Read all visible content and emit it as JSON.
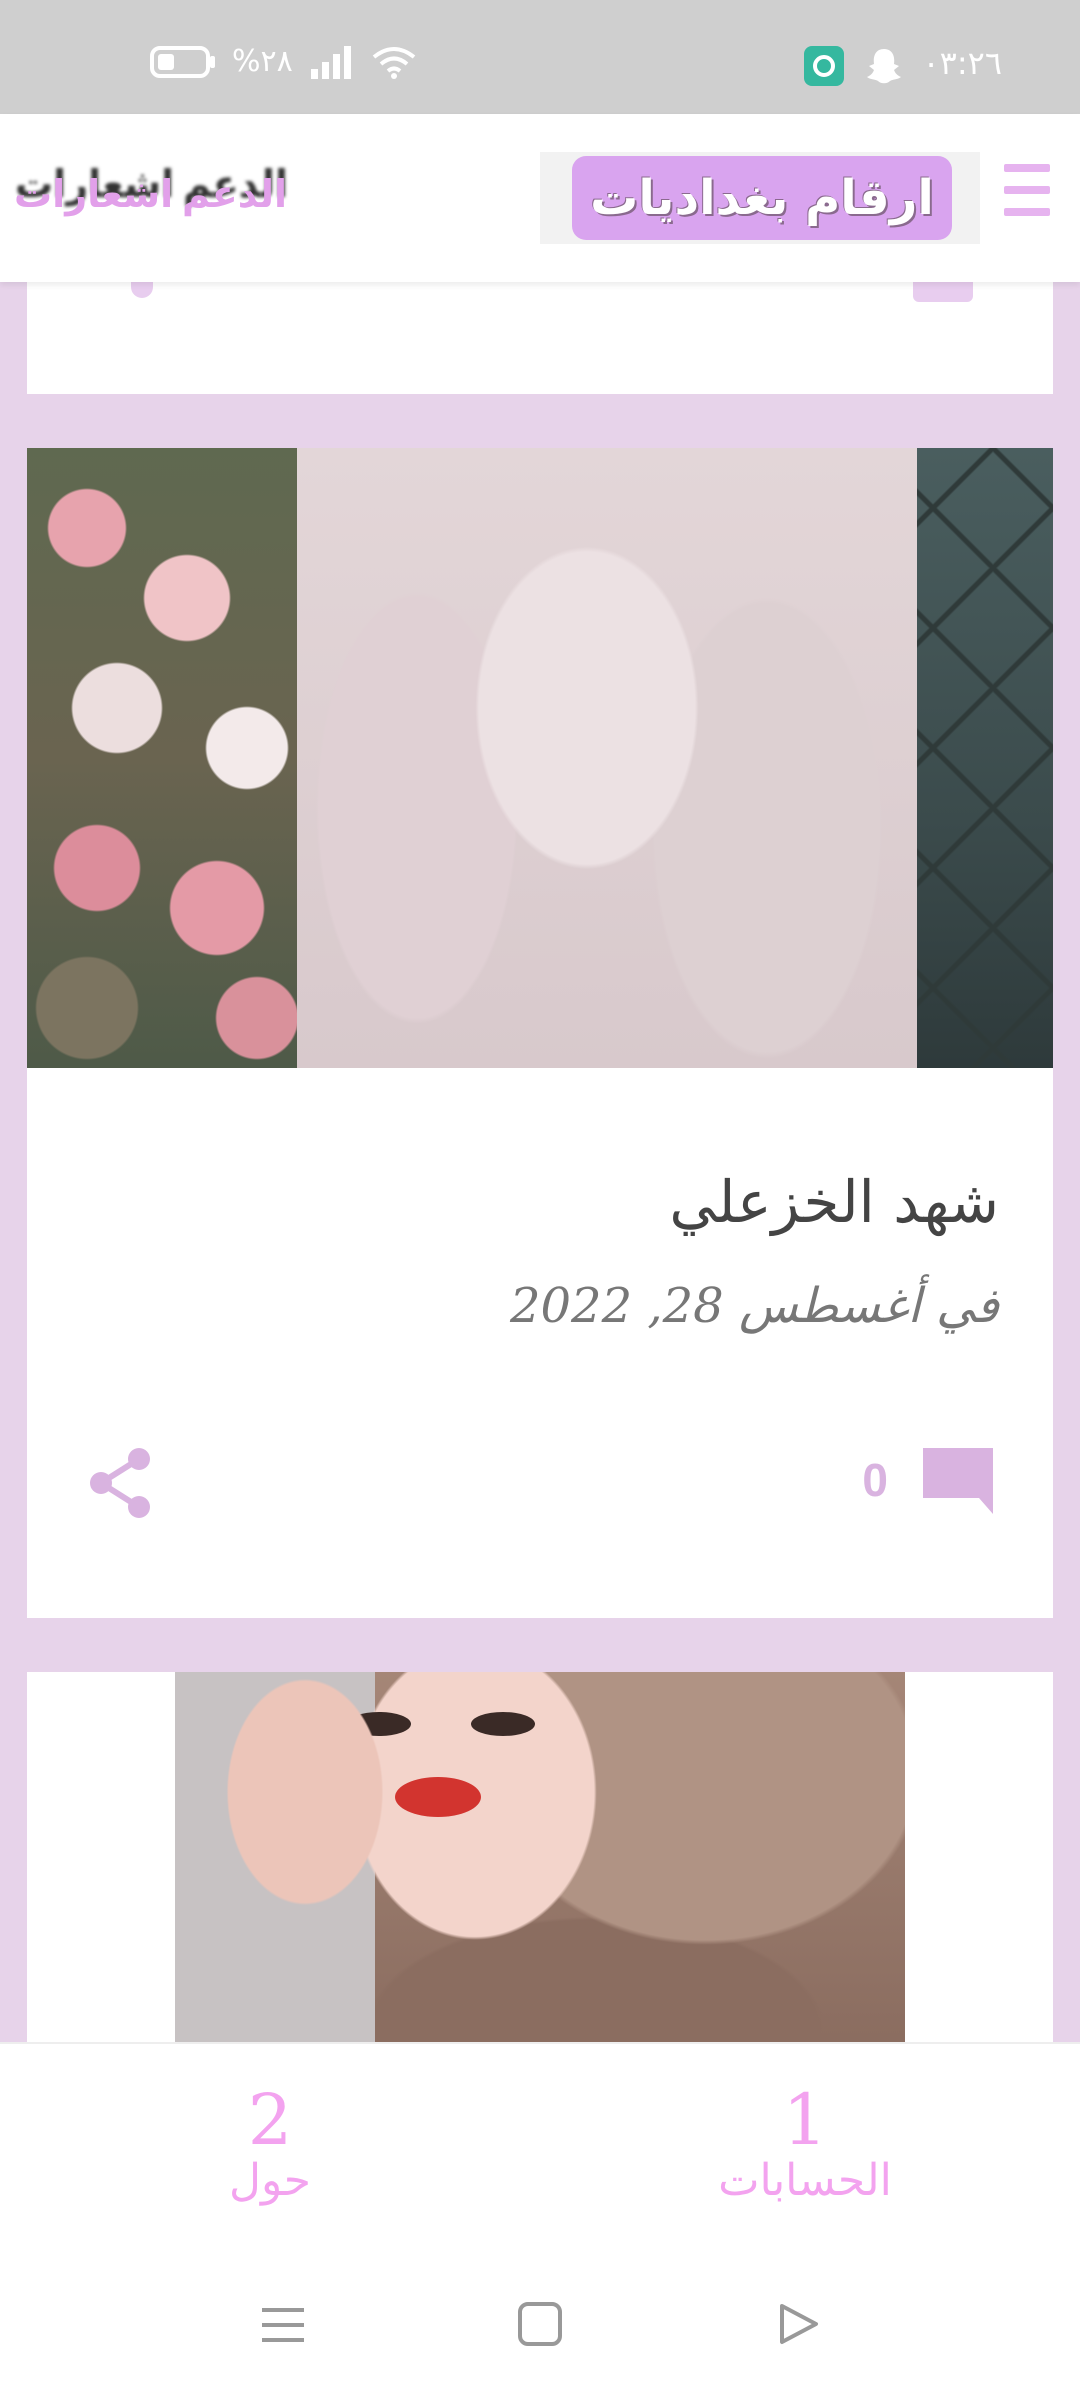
{
  "status_bar": {
    "time": "٠٣:٢٦",
    "battery": "%٢٨",
    "icons": [
      "camera-app-icon",
      "snapchat-icon",
      "wifi-icon",
      "signal-icon",
      "battery-icon"
    ]
  },
  "header": {
    "brand": "ارقام بغداديات",
    "support_link": "الدعم",
    "notifications_link": "اشعارات",
    "menu_icon": "hamburger-menu-icon"
  },
  "post": {
    "title": "شهد الخزعلي",
    "date": "في أغسطس 28, 2022",
    "comment_count": "0",
    "comment_icon": "comment-icon",
    "share_icon": "share-icon"
  },
  "bottom_nav": {
    "items": [
      {
        "number": "1",
        "label": "الحسابات"
      },
      {
        "number": "2",
        "label": "حول"
      }
    ]
  },
  "colors": {
    "accent": "#f3a3ef",
    "brand_bg": "#d9a4ef",
    "page_bg": "#e7d3ea",
    "icon": "#d9b3e0"
  }
}
